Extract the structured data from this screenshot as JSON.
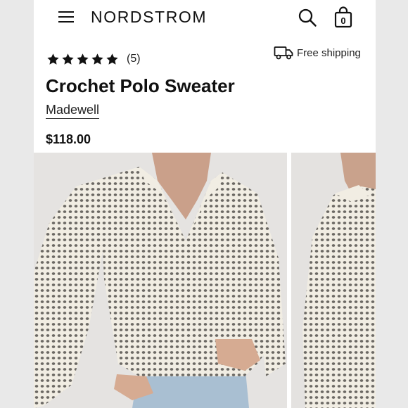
{
  "header": {
    "brand": "NORDSTROM",
    "menu_icon": "hamburger-menu-icon",
    "search_icon": "search-icon",
    "bag_icon": "shopping-bag-icon",
    "bag_count": "0"
  },
  "product": {
    "rating": 5,
    "rating_max": 5,
    "review_count": "(5)",
    "shipping_label": "Free shipping",
    "shipping_icon": "truck-icon",
    "title": "Crochet Polo Sweater",
    "brand": "Madewell",
    "price": "$118.00"
  },
  "gallery": {
    "images": [
      {
        "alt": "Model wearing ivory crochet polo sweater, front view"
      },
      {
        "alt": "Model wearing ivory crochet polo sweater, side view"
      }
    ]
  },
  "colors": {
    "sweater": "#f1ede3",
    "background": "#e5e3e1",
    "text": "#111111"
  }
}
